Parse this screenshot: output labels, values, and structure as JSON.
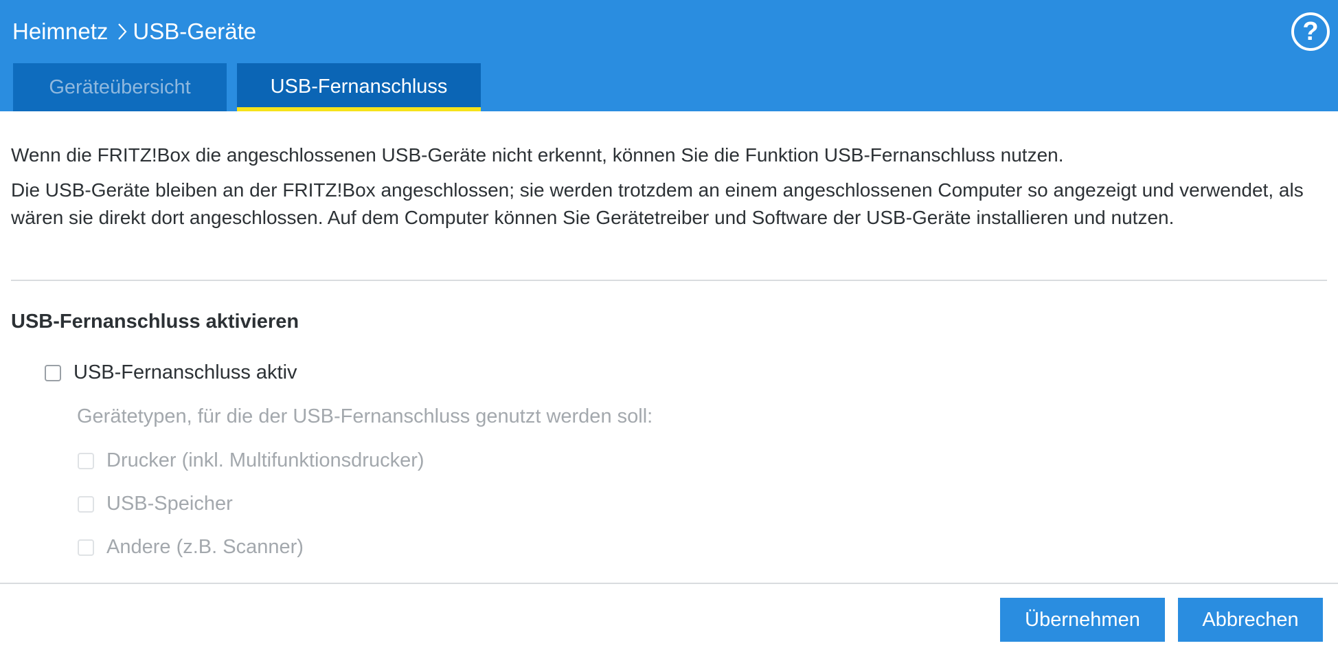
{
  "header": {
    "breadcrumb": {
      "parent": "Heimnetz",
      "current": "USB-Geräte"
    },
    "help_label": "?",
    "tabs": [
      {
        "label": "Geräteübersicht",
        "active": false
      },
      {
        "label": "USB-Fernanschluss",
        "active": true
      }
    ]
  },
  "main": {
    "intro_line1": "Wenn die FRITZ!Box die angeschlossenen USB-Geräte nicht erkennt, können Sie die Funktion USB-Fernanschluss nutzen.",
    "intro_line2": "Die USB-Geräte bleiben an der FRITZ!Box angeschlossen; sie werden trotzdem an einem angeschlossenen Computer so angezeigt und verwendet, als wären sie direkt dort angeschlossen. Auf dem Computer können Sie Gerätetreiber und Software der USB-Geräte installieren und nutzen.",
    "section_title": "USB-Fernanschluss aktivieren",
    "main_checkbox": {
      "label": "USB-Fernanschluss aktiv",
      "checked": false
    },
    "device_types_hint": "Gerätetypen, für die der USB-Fernanschluss genutzt werden soll:",
    "device_types": [
      {
        "label": "Drucker (inkl. Multifunktionsdrucker)",
        "checked": false,
        "disabled": true
      },
      {
        "label": "USB-Speicher",
        "checked": false,
        "disabled": true
      },
      {
        "label": "Andere (z.B. Scanner)",
        "checked": false,
        "disabled": true
      }
    ]
  },
  "footer": {
    "apply_label": "Übernehmen",
    "cancel_label": "Abbrechen"
  },
  "colors": {
    "header_bg": "#2a8de0",
    "tab_bg": "#0e6cbe",
    "tab_active_underline": "#f6e21a",
    "button_bg": "#2a8de0"
  }
}
